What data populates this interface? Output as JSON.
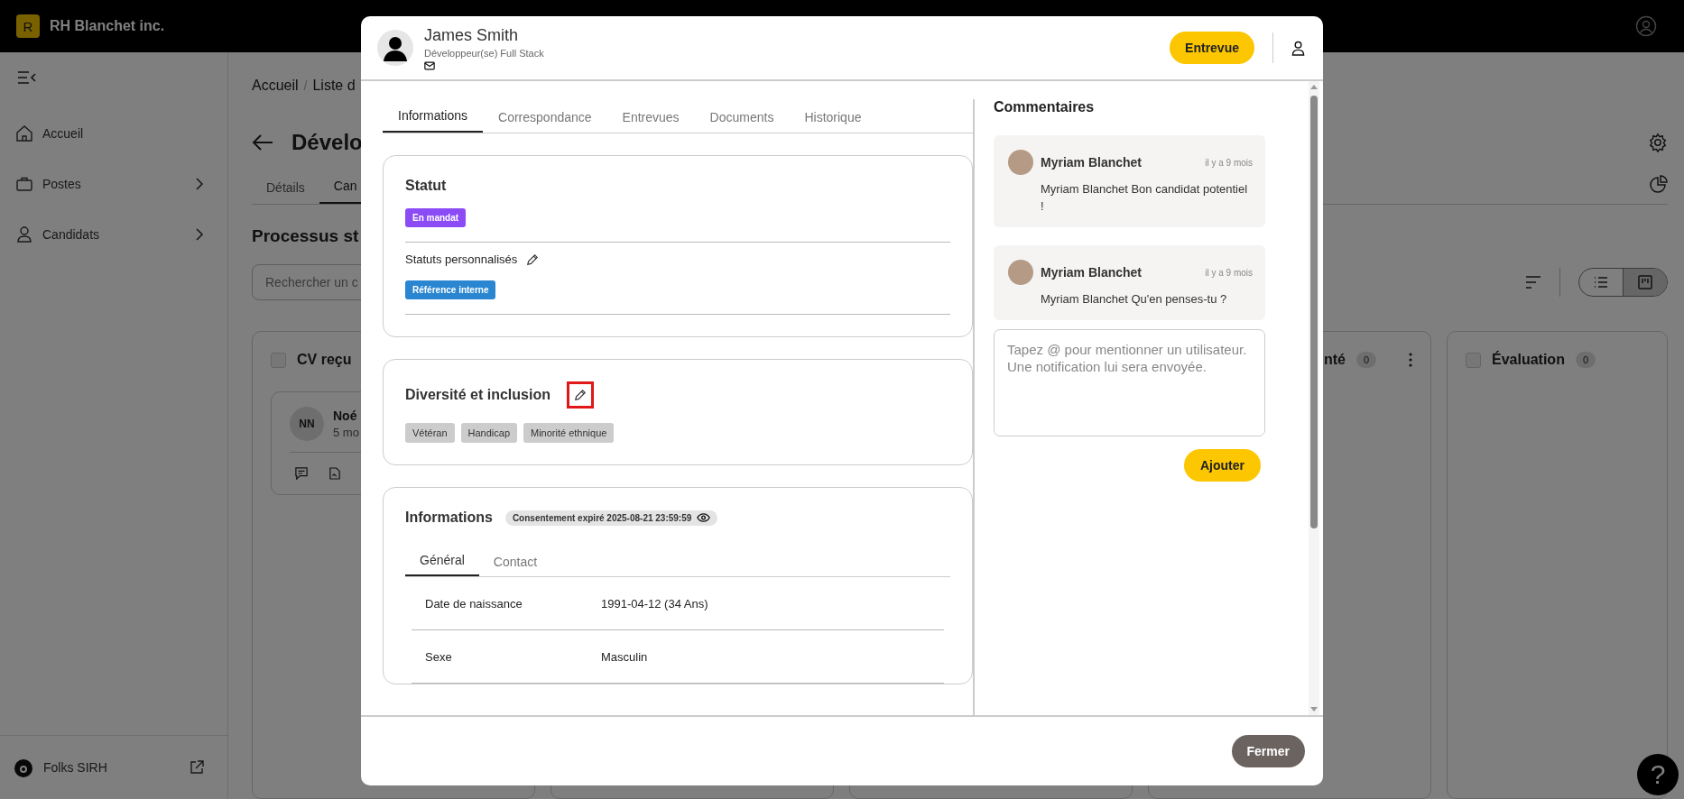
{
  "app": {
    "logo_letter": "R",
    "brand": "RH Blanchet inc."
  },
  "sidebar": {
    "items": [
      {
        "label": "Accueil",
        "submenu": false
      },
      {
        "label": "Postes",
        "submenu": true
      },
      {
        "label": "Candidats",
        "submenu": true
      }
    ],
    "footer": "Folks SIRH"
  },
  "help_button": "?",
  "page": {
    "breadcrumb": [
      "Accueil",
      "/",
      "Liste d"
    ],
    "title": "Dévelo",
    "tabs": [
      {
        "label": "Détails",
        "selected": false
      },
      {
        "label": "Can",
        "selected": true
      }
    ],
    "section_title": "Processus st",
    "search": {
      "placeholder": "Rechercher un c"
    },
    "columns": [
      {
        "title": "CV reçu",
        "checked": false,
        "cards": [
          {
            "initials": "NN",
            "name": "Noé",
            "meta": "5 mo"
          }
        ]
      },
      {
        "title": "nté",
        "count": "0"
      },
      {
        "title": "Évaluation",
        "checked": false,
        "count": "0"
      }
    ]
  },
  "modal": {
    "candidate": {
      "name": "James Smith",
      "role": "Développeur(se) Full Stack"
    },
    "interview_button": "Entrevue",
    "tabs": [
      {
        "label": "Informations",
        "selected": true
      },
      {
        "label": "Correspondance",
        "selected": false
      },
      {
        "label": "Entrevues",
        "selected": false
      },
      {
        "label": "Documents",
        "selected": false
      },
      {
        "label": "Historique",
        "selected": false
      }
    ],
    "status": {
      "title": "Statut",
      "tags": [
        {
          "label": "En mandat",
          "color": "#8b4cf6"
        }
      ],
      "custom_label": "Statuts personnalisés",
      "custom_tags": [
        {
          "label": "Référence interne",
          "color": "#2a86d1"
        }
      ]
    },
    "diversity": {
      "title": "Diversité et inclusion",
      "edit_highlighted": true,
      "tags": [
        "Vétéran",
        "Handicap",
        "Minorité ethnique"
      ]
    },
    "informations": {
      "title": "Informations",
      "consent": "Consentement expiré 2025-08-21 23:59:59",
      "tabs": [
        {
          "label": "Général",
          "selected": true
        },
        {
          "label": "Contact",
          "selected": false
        }
      ],
      "rows": [
        {
          "label": "Date de naissance",
          "value": "1991-04-12 (34 Ans)"
        },
        {
          "label": "Sexe",
          "value": "Masculin"
        }
      ]
    },
    "comments": {
      "title": "Commentaires",
      "items": [
        {
          "author": "Myriam Blanchet",
          "time": "il y a 9 mois",
          "text": "Myriam Blanchet Bon candidat potentiel !"
        },
        {
          "author": "Myriam Blanchet",
          "time": "il y a 9 mois",
          "text": "Myriam Blanchet Qu'en penses-tu ?"
        }
      ],
      "placeholder": "Tapez @ pour mentionner un utilisateur. Une notification lui sera envoyée.",
      "submit": "Ajouter"
    },
    "close_button": "Fermer"
  }
}
